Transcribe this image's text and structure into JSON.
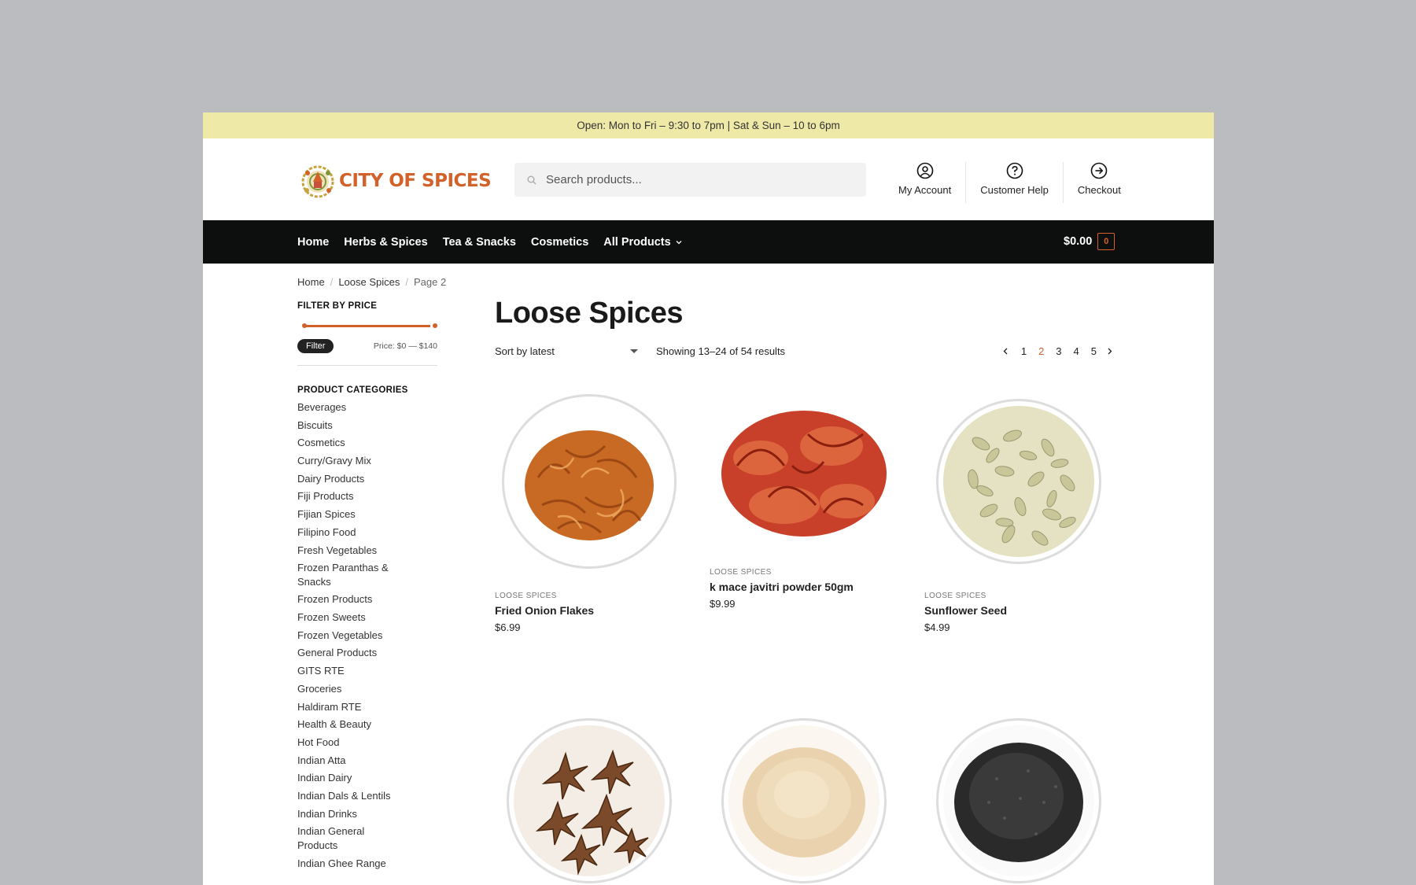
{
  "topbar": {
    "hours": "Open: Mon to Fri – 9:30 to 7pm | Sat & Sun – 10 to 6pm"
  },
  "logo": {
    "text": "CITY OF SPICES"
  },
  "search": {
    "placeholder": "Search products..."
  },
  "header_links": {
    "account": "My Account",
    "help": "Customer Help",
    "checkout": "Checkout"
  },
  "nav": {
    "items": [
      "Home",
      "Herbs & Spices",
      "Tea & Snacks",
      "Cosmetics",
      "All Products"
    ],
    "cart_total": "$0.00",
    "cart_count": "0"
  },
  "breadcrumb": {
    "home": "Home",
    "category": "Loose Spices",
    "current": "Page 2"
  },
  "filter": {
    "title": "FILTER BY PRICE",
    "button": "Filter",
    "price_label": "Price: $0 — $140",
    "min": 0,
    "max": 140
  },
  "categories": {
    "title": "PRODUCT CATEGORIES",
    "items": [
      "Beverages",
      "Biscuits",
      "Cosmetics",
      "Curry/Gravy Mix",
      "Dairy Products",
      "Fiji Products",
      "Fijian Spices",
      "Filipino Food",
      "Fresh Vegetables",
      "Frozen Paranthas & Snacks",
      "Frozen Products",
      "Frozen Sweets",
      "Frozen Vegetables",
      "General Products",
      "GITS RTE",
      "Groceries",
      "Haldiram RTE",
      "Health & Beauty",
      "Hot Food",
      "Indian Atta",
      "Indian Dairy",
      "Indian Dals & Lentils",
      "Indian Drinks",
      "Indian General Products",
      "Indian Ghee Range"
    ]
  },
  "main": {
    "title": "Loose Spices",
    "sort": "Sort by latest",
    "result_count": "Showing 13–24 of 54 results",
    "pages": [
      "1",
      "2",
      "3",
      "4",
      "5"
    ],
    "current_page": "2"
  },
  "products": [
    {
      "category": "LOOSE SPICES",
      "name": "Fried Onion Flakes",
      "price": "$6.99",
      "image": "fried-onion-flakes"
    },
    {
      "category": "LOOSE SPICES",
      "name": "k mace javitri powder 50gm",
      "price": "$9.99",
      "image": "mace-javitri"
    },
    {
      "category": "LOOSE SPICES",
      "name": "Sunflower Seed",
      "price": "$4.99",
      "image": "sunflower-seeds"
    },
    {
      "image": "star-anise"
    },
    {
      "image": "sesame-powder"
    },
    {
      "image": "black-seeds"
    }
  ],
  "colors": {
    "accent": "#d2612a",
    "topbar": "#efe9a8",
    "nav": "#0c0f0e"
  }
}
